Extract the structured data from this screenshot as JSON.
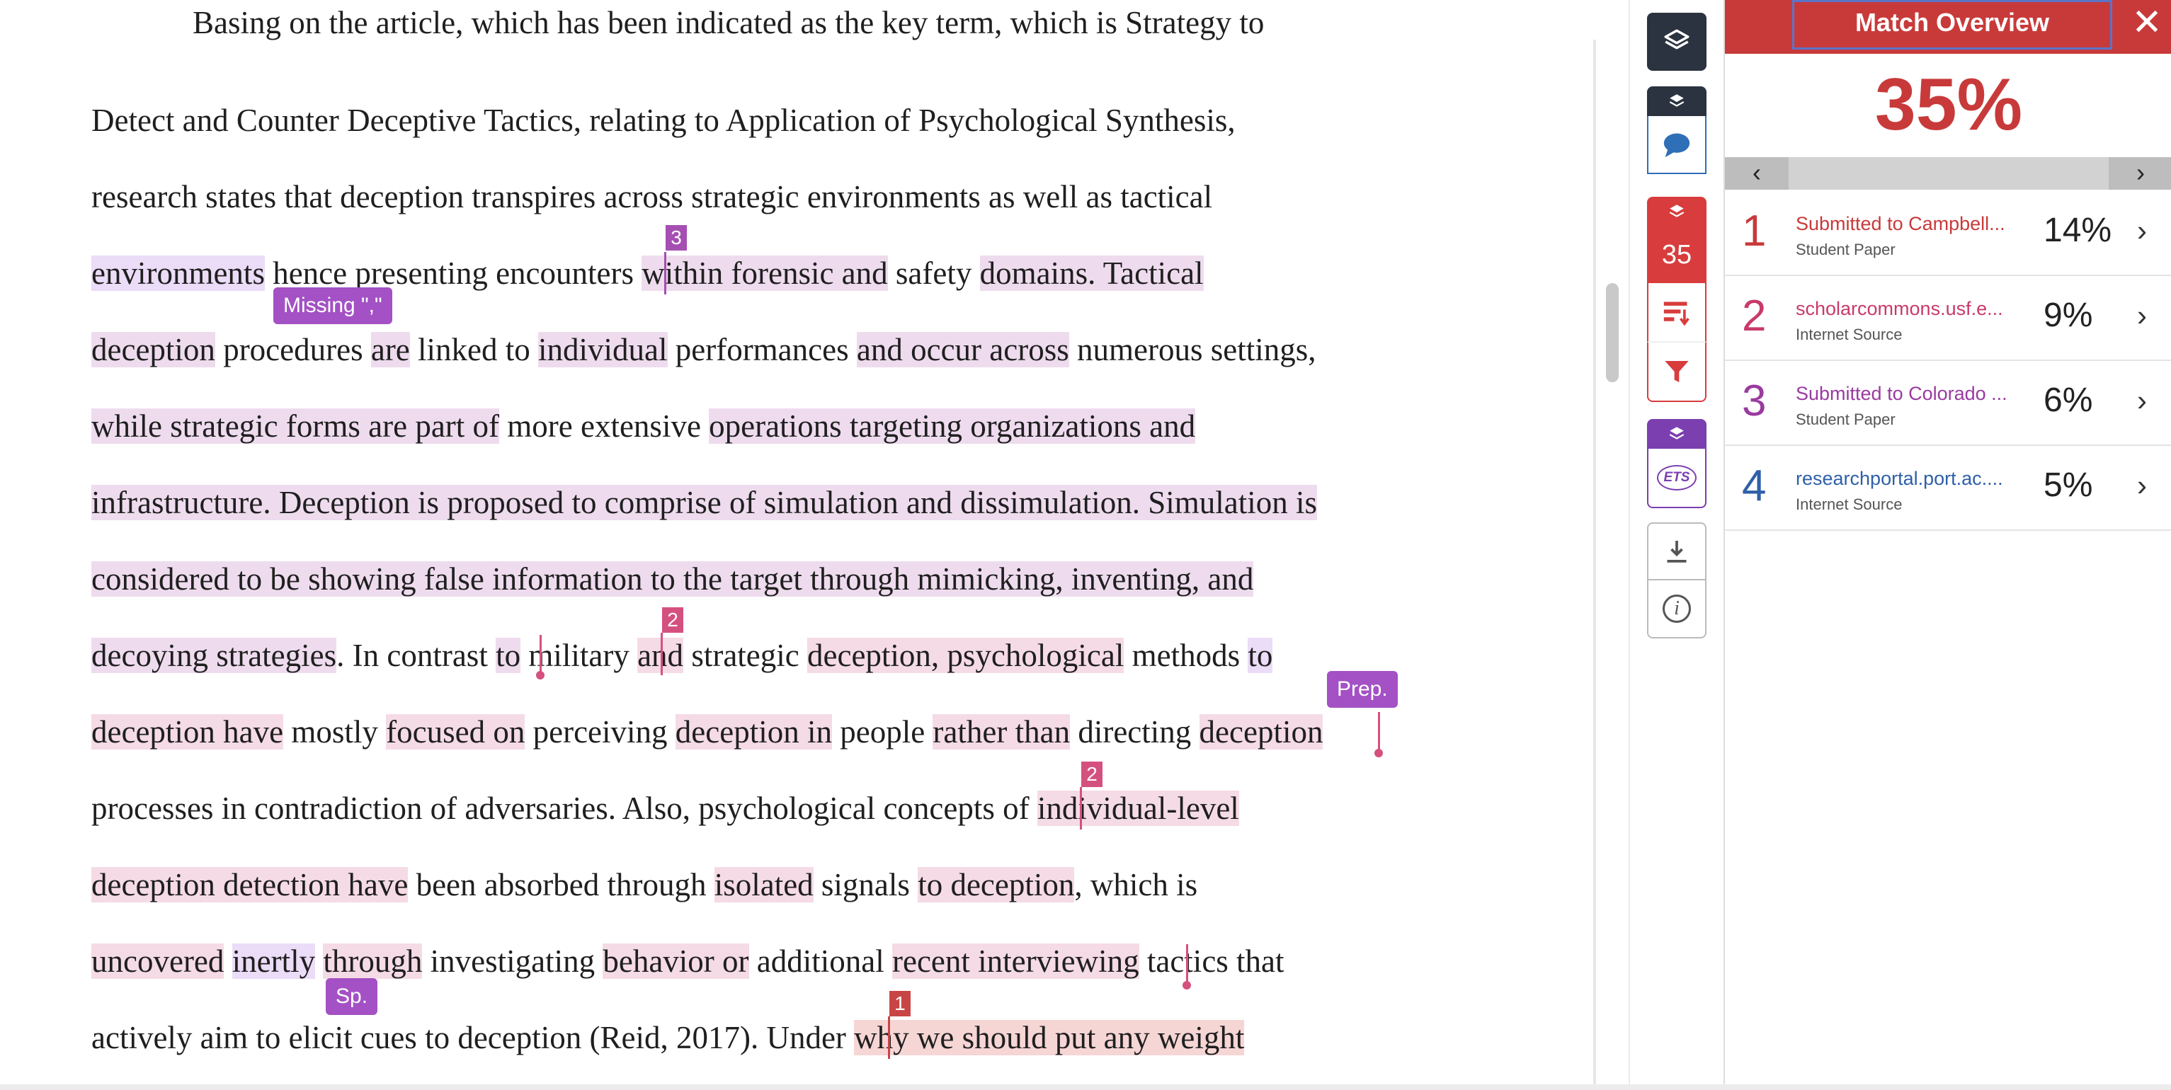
{
  "document": {
    "lines": [
      {
        "segments": [
          {
            "text": "Basing on the article, which has been indicated as the key term, which is Strategy to"
          }
        ]
      },
      {
        "segments": [
          {
            "text": "Detect and Counter Deceptive Tactics, relating to Application of Psychological Synthesis,"
          }
        ]
      },
      {
        "segments": [
          {
            "text": "research states that deception transpires across strategic environments as well as tactical"
          }
        ]
      },
      {
        "segments": [
          {
            "text": "environments",
            "hl": "g"
          },
          {
            "text": " hence presenting encounters "
          },
          {
            "text": "within forensic and",
            "hl": "3"
          },
          {
            "text": " safety "
          },
          {
            "text": "domains. Tactical",
            "hl": "3"
          }
        ]
      },
      {
        "segments": [
          {
            "text": "deception",
            "hl": "3"
          },
          {
            "text": " procedures "
          },
          {
            "text": "are",
            "hl": "3"
          },
          {
            "text": " linked to "
          },
          {
            "text": "individual",
            "hl": "3"
          },
          {
            "text": " performances "
          },
          {
            "text": "and occur across",
            "hl": "3"
          },
          {
            "text": " numerous settings,"
          }
        ]
      },
      {
        "segments": [
          {
            "text": "while strategic forms are part of",
            "hl": "3"
          },
          {
            "text": " more extensive "
          },
          {
            "text": "operations targeting organizations and",
            "hl": "3"
          }
        ]
      },
      {
        "segments": [
          {
            "text": "infrastructure. Deception is proposed to comprise of simulation and dissimulation. Simulation is",
            "hl": "3"
          }
        ]
      },
      {
        "segments": [
          {
            "text": "considered to be showing false information to the target through mimicking, inventing, and",
            "hl": "3"
          }
        ]
      },
      {
        "segments": [
          {
            "text": "decoying strategies",
            "hl": "3"
          },
          {
            "text": ". In contrast "
          },
          {
            "text": "to",
            "hl": "3"
          },
          {
            "text": " military "
          },
          {
            "text": "and",
            "hl": "2"
          },
          {
            "text": " strategic "
          },
          {
            "text": "deception, psychological",
            "hl": "2"
          },
          {
            "text": " methods "
          },
          {
            "text": "to",
            "hl": "g"
          }
        ]
      },
      {
        "segments": [
          {
            "text": "deception have",
            "hl": "2"
          },
          {
            "text": " mostly "
          },
          {
            "text": "focused on",
            "hl": "2"
          },
          {
            "text": " perceiving "
          },
          {
            "text": "deception in",
            "hl": "2"
          },
          {
            "text": " people "
          },
          {
            "text": "rather than",
            "hl": "2"
          },
          {
            "text": " directing "
          },
          {
            "text": "deception",
            "hl": "2"
          }
        ]
      },
      {
        "segments": [
          {
            "text": "processes in contradiction of adversaries. Also, psychological concepts of "
          },
          {
            "text": "individual-level",
            "hl": "2"
          }
        ]
      },
      {
        "segments": [
          {
            "text": "deception detection have",
            "hl": "2"
          },
          {
            "text": " been absorbed through "
          },
          {
            "text": "isolated",
            "hl": "2"
          },
          {
            "text": " signals "
          },
          {
            "text": "to deception",
            "hl": "2"
          },
          {
            "text": ", which is"
          }
        ]
      },
      {
        "segments": [
          {
            "text": "uncovered",
            "hl": "2"
          },
          {
            "text": " "
          },
          {
            "text": "inertly",
            "hl": "g"
          },
          {
            "text": " "
          },
          {
            "text": "through",
            "hl": "2"
          },
          {
            "text": " investigating "
          },
          {
            "text": "behavior or",
            "hl": "2"
          },
          {
            "text": " additional "
          },
          {
            "text": "recent interviewing",
            "hl": "2"
          },
          {
            "text": " tactics that"
          }
        ]
      },
      {
        "segments": [
          {
            "text": "actively aim to elicit cues to deception (Reid, 2017). Under "
          },
          {
            "text": "why we should put any weight",
            "hl": "1"
          }
        ]
      }
    ],
    "markers": [
      {
        "label": "3",
        "match": "3"
      },
      {
        "label": "2",
        "match": "2"
      },
      {
        "label": "2",
        "match": "2"
      },
      {
        "label": "1",
        "match": "1"
      }
    ],
    "grammar_tags": [
      "Missing \",\"",
      "Prep.",
      "Sp."
    ]
  },
  "rail": {
    "match_count": "35",
    "ets_label": "ETS",
    "info_label": "i"
  },
  "panel": {
    "title": "Match Overview",
    "close_glyph": "✕",
    "overall_percent": "35%",
    "prev_glyph": "‹",
    "next_glyph": "›",
    "sources": [
      {
        "rank": "1",
        "name": "Submitted to Campbell...",
        "type": "Student Paper",
        "percent": "14%",
        "color": "#c83a3a"
      },
      {
        "rank": "2",
        "name": "scholarcommons.usf.e...",
        "type": "Internet Source",
        "percent": "9%",
        "color": "#c83a6a"
      },
      {
        "rank": "3",
        "name": "Submitted to Colorado ...",
        "type": "Student Paper",
        "percent": "6%",
        "color": "#9a3aa0"
      },
      {
        "rank": "4",
        "name": "researchportal.port.ac....",
        "type": "Internet Source",
        "percent": "5%",
        "color": "#2f5fa8"
      }
    ]
  },
  "colors": {
    "match1": "#c83a3a",
    "match2": "#d4507f",
    "match3": "#a54fb2",
    "grammar": "#a351c4",
    "rail_dark": "#2b3340",
    "rail_blue": "#2f6fb8",
    "rail_red": "#d83c3c",
    "rail_purple": "#7b3fb0"
  }
}
